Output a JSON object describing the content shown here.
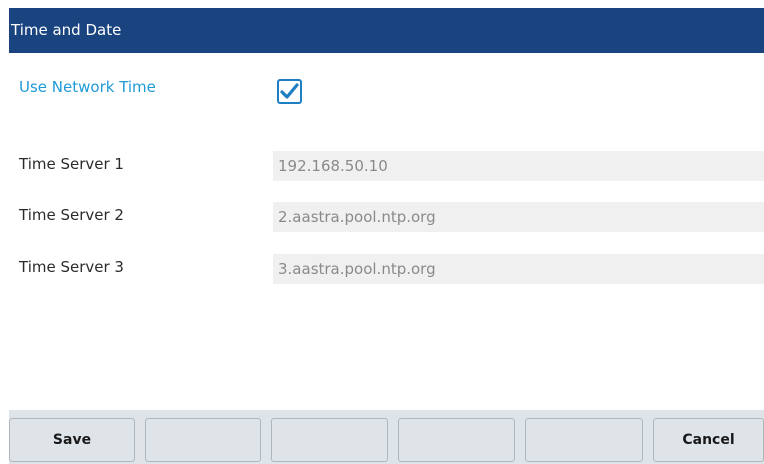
{
  "header": {
    "title": "Time and Date"
  },
  "network_time": {
    "label": "Use Network Time",
    "checked": true,
    "accent_color": "#1f9ad6"
  },
  "servers": [
    {
      "label": "Time Server 1",
      "value": "192.168.50.10"
    },
    {
      "label": "Time Server 2",
      "value": "2.aastra.pool.ntp.org"
    },
    {
      "label": "Time Server 3",
      "value": "3.aastra.pool.ntp.org"
    }
  ],
  "softkeys": {
    "key1": "Save",
    "key2": "",
    "key3": "",
    "key4": "",
    "key5": "",
    "key6": "Cancel"
  },
  "colors": {
    "title_bar": "#1a447f",
    "softkey_bar": "#dfe4e8",
    "field_background": "#f0f0f0"
  },
  "icons": {
    "checkbox": "checkmark-icon"
  }
}
